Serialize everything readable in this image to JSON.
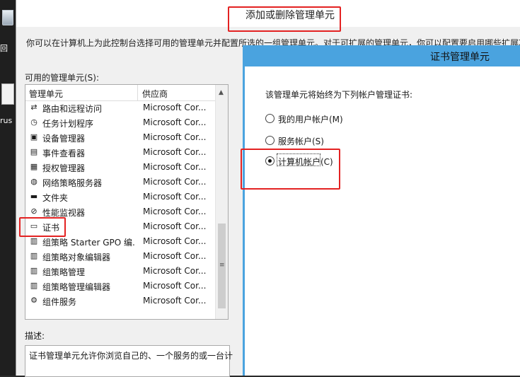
{
  "desktop": {
    "recycle_label": "回",
    "rus_label": "rus"
  },
  "dialog": {
    "title": "添加或删除管理单元",
    "intro": "你可以在计算机上为此控制台选择可用的管理单元并配置所选的一组管理单元。对于可扩展的管理单元，你可以配置要启用哪些扩展项",
    "available_label": "可用的管理单元(S):",
    "columns": [
      "管理单元",
      "供应商"
    ],
    "rows": [
      {
        "name": "路由和远程访问",
        "vendor": "Microsoft Cor...",
        "icon": "network-icon",
        "glyph": "⇄"
      },
      {
        "name": "任务计划程序",
        "vendor": "Microsoft Cor...",
        "icon": "clock-icon",
        "glyph": "◷"
      },
      {
        "name": "设备管理器",
        "vendor": "Microsoft Cor...",
        "icon": "device-icon",
        "glyph": "▣"
      },
      {
        "name": "事件查看器",
        "vendor": "Microsoft Cor...",
        "icon": "event-viewer-icon",
        "glyph": "▤"
      },
      {
        "name": "授权管理器",
        "vendor": "Microsoft Cor...",
        "icon": "authorization-icon",
        "glyph": "▦"
      },
      {
        "name": "网络策略服务器",
        "vendor": "Microsoft Cor...",
        "icon": "globe-icon",
        "glyph": "◍"
      },
      {
        "name": "文件夹",
        "vendor": "Microsoft Cor...",
        "icon": "folder-icon",
        "glyph": "▬"
      },
      {
        "name": "性能监视器",
        "vendor": "Microsoft Cor...",
        "icon": "performance-icon",
        "glyph": "⊘"
      },
      {
        "name": "证书",
        "vendor": "Microsoft Cor...",
        "icon": "certificate-icon",
        "glyph": "▭"
      },
      {
        "name": "组策略 Starter GPO 编...",
        "vendor": "Microsoft Cor...",
        "icon": "policy-icon",
        "glyph": "▥"
      },
      {
        "name": "组策略对象编辑器",
        "vendor": "Microsoft Cor...",
        "icon": "policy-icon",
        "glyph": "▥"
      },
      {
        "name": "组策略管理",
        "vendor": "Microsoft Cor...",
        "icon": "policy-mgmt-icon",
        "glyph": "▥"
      },
      {
        "name": "组策略管理编辑器",
        "vendor": "Microsoft Cor...",
        "icon": "policy-icon",
        "glyph": "▥"
      },
      {
        "name": "组件服务",
        "vendor": "Microsoft Cor...",
        "icon": "component-icon",
        "glyph": "⚙"
      }
    ],
    "desc_label": "描述:",
    "desc_text": "证书管理单元允许你浏览自己的、一个服务的或一台计"
  },
  "cert_dialog": {
    "title": "证书管理单元",
    "prompt": "该管理单元将始终为下列帐户管理证书:",
    "options": [
      {
        "label": "我的用户帐户(M)",
        "selected": false
      },
      {
        "label": "服务帐户(S)",
        "selected": false
      },
      {
        "label": "计算机帐户(C)",
        "selected": true
      }
    ]
  },
  "colors": {
    "annotation_red": "#e32222",
    "cert_titlebar": "#4aa3df"
  }
}
